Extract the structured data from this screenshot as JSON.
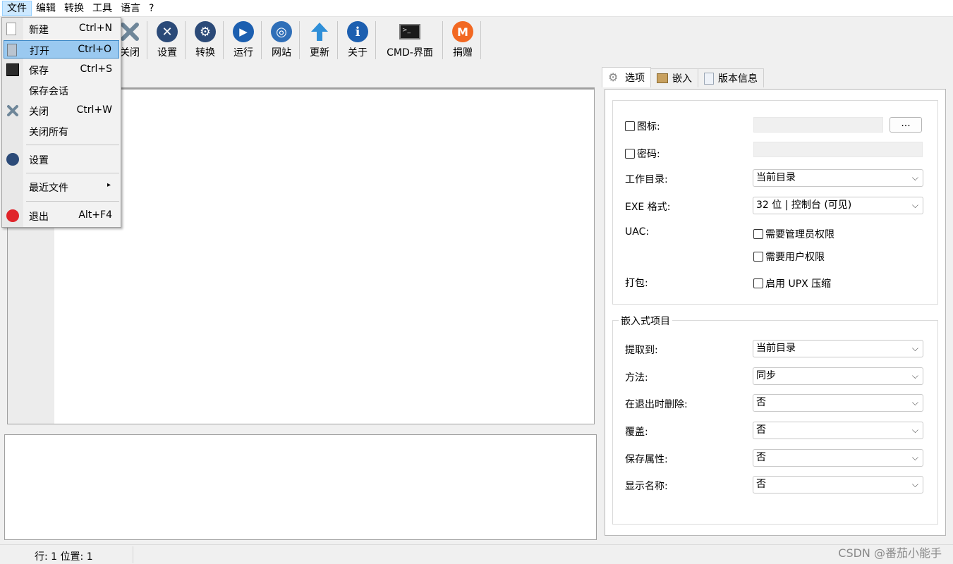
{
  "menubar": {
    "items": [
      "文件",
      "编辑",
      "转换",
      "工具",
      "语言",
      "?"
    ]
  },
  "toolbar": {
    "buttons": [
      {
        "label": "关闭",
        "icon": "close-x-icon"
      },
      {
        "label": "设置",
        "icon": "settings-icon"
      },
      {
        "label": "转换",
        "icon": "gear-icon"
      },
      {
        "label": "运行",
        "icon": "play-icon"
      },
      {
        "label": "网站",
        "icon": "globe-icon"
      },
      {
        "label": "更新",
        "icon": "up-arrow-icon"
      },
      {
        "label": "关于",
        "icon": "info-icon"
      },
      {
        "label": "CMD-界面",
        "icon": "terminal-icon"
      },
      {
        "label": "捐赠",
        "icon": "monero-icon"
      }
    ]
  },
  "file_menu": {
    "items": [
      {
        "label": "新建",
        "accel": "Ctrl+N",
        "icon": "new-file-icon"
      },
      {
        "label": "打开",
        "accel": "Ctrl+O",
        "icon": "open-folder-icon"
      },
      {
        "label": "保存",
        "accel": "Ctrl+S",
        "icon": "save-icon"
      },
      {
        "label": "保存会话",
        "accel": "",
        "icon": ""
      },
      {
        "label": "关闭",
        "accel": "Ctrl+W",
        "icon": "close-x-icon"
      },
      {
        "label": "关闭所有",
        "accel": "",
        "icon": ""
      },
      {
        "label": "设置",
        "accel": "",
        "icon": "settings-icon"
      },
      {
        "label": "最近文件",
        "accel": "▸",
        "icon": ""
      },
      {
        "label": "退出",
        "accel": "Alt+F4",
        "icon": "exit-icon"
      }
    ]
  },
  "tabs": [
    {
      "label": "选项",
      "icon": "gear-icon"
    },
    {
      "label": "嵌入",
      "icon": "package-icon"
    },
    {
      "label": "版本信息",
      "icon": "document-icon"
    }
  ],
  "options": {
    "icon_label": "图标:",
    "icon_browse": "...",
    "password_label": "密码:",
    "workdir_label": "工作目录:",
    "workdir_value": "当前目录",
    "exe_label": "EXE 格式:",
    "exe_value": "32 位 | 控制台 (可见)",
    "uac_label": "UAC:",
    "uac_admin": "需要管理员权限",
    "uac_user": "需要用户权限",
    "pack_label": "打包:",
    "pack_upx": "启用 UPX 压缩"
  },
  "embedded": {
    "title": "嵌入式项目",
    "rows": [
      {
        "label": "提取到:",
        "value": "当前目录"
      },
      {
        "label": "方法:",
        "value": "同步"
      },
      {
        "label": "在退出时删除:",
        "value": "否"
      },
      {
        "label": "覆盖:",
        "value": "否"
      },
      {
        "label": "保存属性:",
        "value": "否"
      },
      {
        "label": "显示名称:",
        "value": "否"
      }
    ]
  },
  "statusbar": {
    "text": "行: 1  位置: 1"
  },
  "watermark": "CSDN @番茄小能手"
}
